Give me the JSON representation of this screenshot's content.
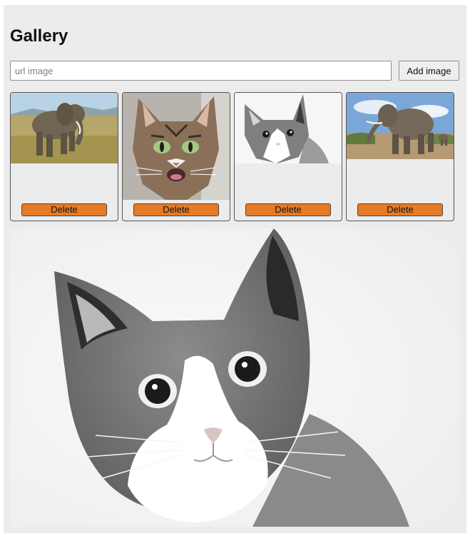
{
  "header": {
    "title": "Gallery"
  },
  "form": {
    "url_placeholder": "url image",
    "url_value": "",
    "add_label": "Add image"
  },
  "gallery": {
    "items": [
      {
        "subject": "elephant-savanna",
        "delete_label": "Delete"
      },
      {
        "subject": "tabby-cat",
        "delete_label": "Delete"
      },
      {
        "subject": "grey-white-cat",
        "delete_label": "Delete"
      },
      {
        "subject": "elephant-walking",
        "delete_label": "Delete"
      }
    ],
    "selected_index": 2
  },
  "colors": {
    "background": "#ececec",
    "delete_button": "#e57b27"
  }
}
